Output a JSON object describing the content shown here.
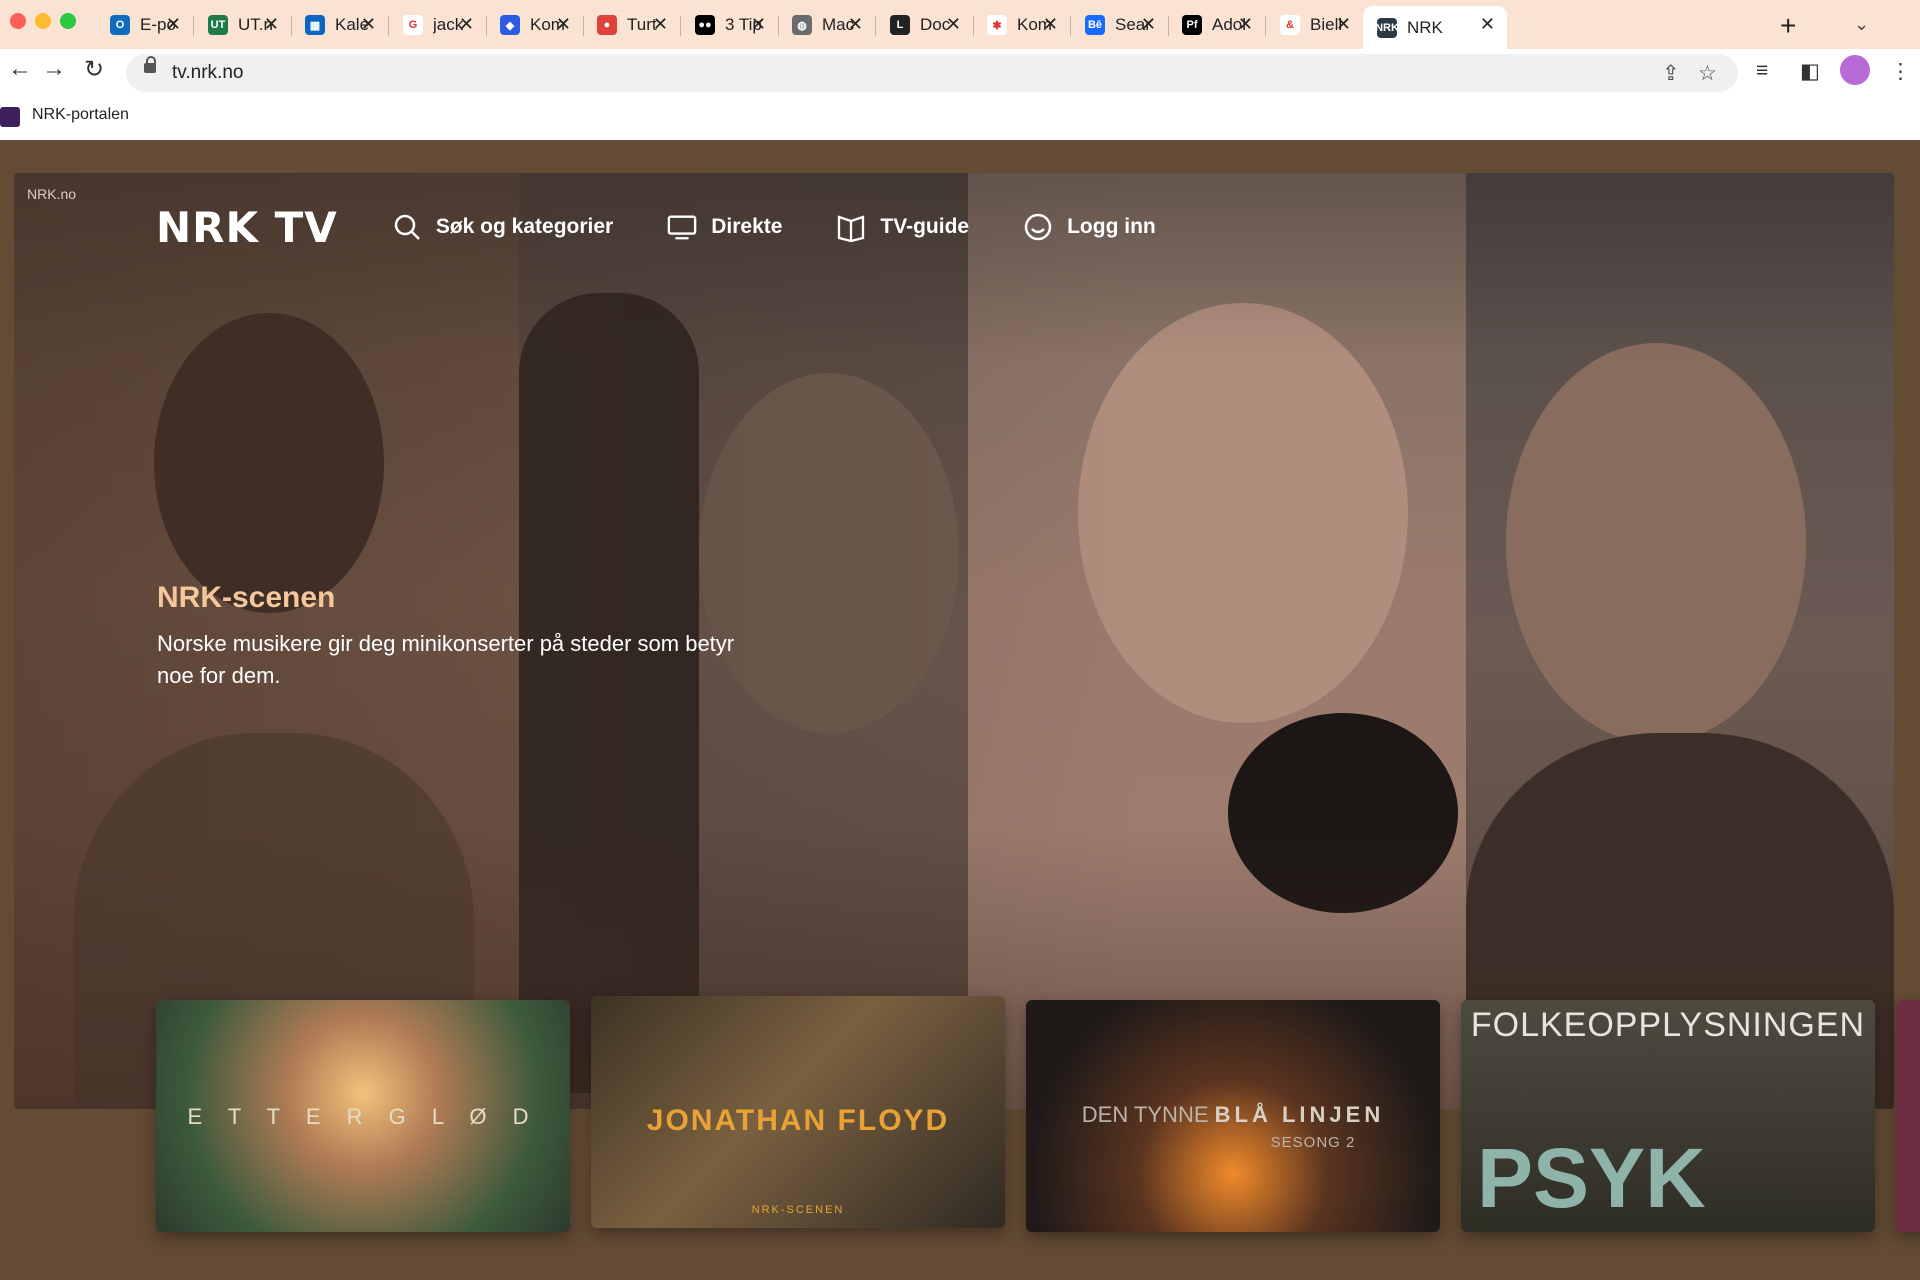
{
  "tabs": [
    {
      "title": "E-po",
      "favicon": "outlook-icon",
      "color": "#0f6cbd",
      "glyph": "O"
    },
    {
      "title": "UT.n",
      "favicon": "ut-icon",
      "color": "#1f7a4a",
      "glyph": "UT"
    },
    {
      "title": "Kale",
      "favicon": "calendar-icon",
      "color": "#0a66c2",
      "glyph": "▦"
    },
    {
      "title": "jack",
      "favicon": "google-icon",
      "color": "#ffffff",
      "glyph": "G"
    },
    {
      "title": "Kom",
      "favicon": "dropbox-icon",
      "color": "#2d5be3",
      "glyph": "◆"
    },
    {
      "title": "Turt",
      "favicon": "maps-pin-icon",
      "color": "#e0413a",
      "glyph": "●"
    },
    {
      "title": "3 Tip",
      "favicon": "medium-icon",
      "color": "#000000",
      "glyph": "●●"
    },
    {
      "title": "Mac",
      "favicon": "globe-icon",
      "color": "#6b6b6b",
      "glyph": "◍"
    },
    {
      "title": "Doc",
      "favicon": "doc-icon",
      "color": "#222222",
      "glyph": "L"
    },
    {
      "title": "Kom",
      "favicon": "asterisk-icon",
      "color": "#ffffff",
      "glyph": "✱"
    },
    {
      "title": "Sear",
      "favicon": "behance-icon",
      "color": "#1769ff",
      "glyph": "Bē"
    },
    {
      "title": "Adol",
      "favicon": "pf-icon",
      "color": "#000000",
      "glyph": "Pf"
    },
    {
      "title": "Biell",
      "favicon": "ampersand-icon",
      "color": "#ffffff",
      "glyph": "&"
    },
    {
      "title": "NRK",
      "favicon": "nrk-tv-icon",
      "color": "#2b3a44",
      "glyph": "NRK"
    }
  ],
  "browser": {
    "url": "tv.nrk.no",
    "bookmark": "NRK-portalen"
  },
  "page": {
    "site_label": "NRK.no",
    "logo": "NRK TV",
    "nav": {
      "search": "Søk og kategorier",
      "live": "Direkte",
      "guide": "TV-guide",
      "login": "Logg inn"
    },
    "hero_title": "NRK-scenen",
    "hero_desc": "Norske musikere gir deg minikonserter på steder som betyr noe for dem.",
    "cards": [
      {
        "title": "E T T E R G L Ø D"
      },
      {
        "title": "JONATHAN FLOYD",
        "sub": "NRK-SCENEN"
      },
      {
        "title_a": "DEN TYNNE",
        "title_b": "BLÅ LINJEN",
        "sub": "SESONG 2"
      },
      {
        "top": "FOLKEOPPLYSNINGEN",
        "big": "PSYK"
      }
    ]
  },
  "colors": {
    "page_bg": "#634b34",
    "hero_title": "#f5c79a",
    "tabstrip": "#fbe3d3"
  }
}
